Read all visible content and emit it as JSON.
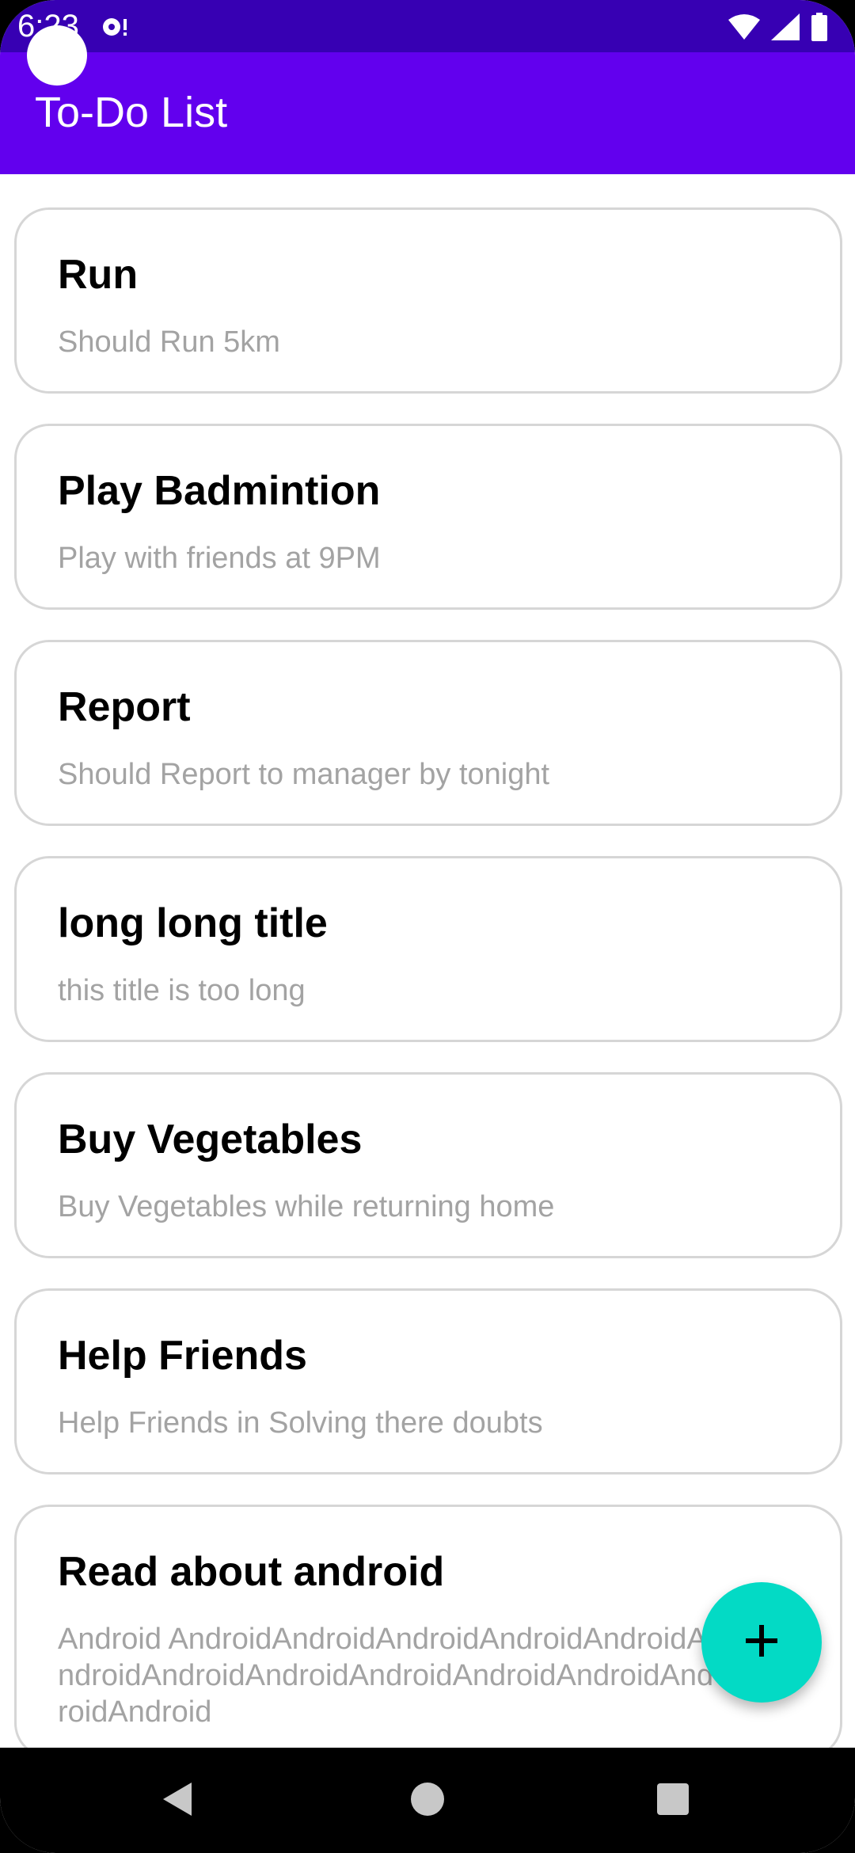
{
  "status_bar": {
    "time": "6:23",
    "icons": [
      "notification-icon",
      "wifi-icon",
      "signal-icon",
      "battery-icon"
    ]
  },
  "app_bar": {
    "title": "To-Do List",
    "color": "#6200ee",
    "status_color": "#3700b3"
  },
  "todos": [
    {
      "title": "Run",
      "description": "Should Run 5km"
    },
    {
      "title": "Play Badmintion",
      "description": "Play with friends at 9PM"
    },
    {
      "title": "Report",
      "description": "Should Report to manager by tonight"
    },
    {
      "title": "long long title",
      "description": "this title is too long"
    },
    {
      "title": "Buy Vegetables",
      "description": "Buy Vegetables while returning home"
    },
    {
      "title": "Help Friends",
      "description": "Help Friends in Solving there doubts"
    },
    {
      "title": "Read about android",
      "description": "Android AndroidAndroidAndroidAndroidAndroidAndroidAndroidAndroidAndroidAndroidAndroidAndroidAndroid"
    }
  ],
  "fab": {
    "icon": "plus-icon",
    "color": "#03dac5"
  },
  "nav_bar": {
    "icons": [
      "back-icon",
      "home-icon",
      "recents-icon"
    ]
  }
}
